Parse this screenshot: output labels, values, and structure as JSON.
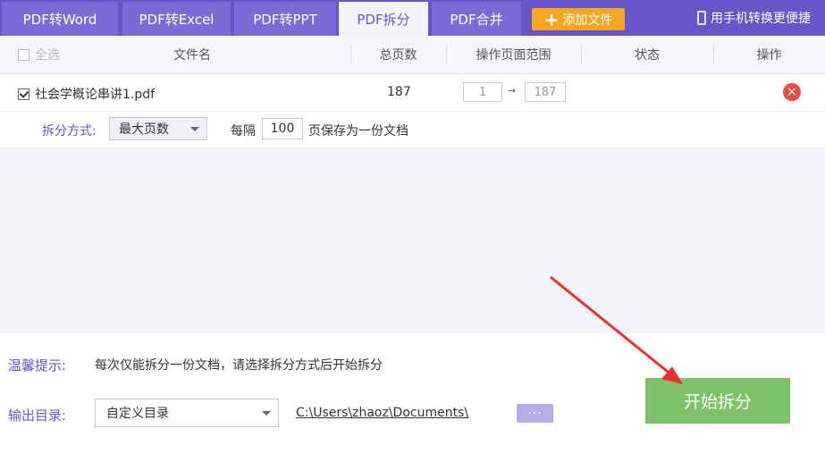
{
  "tabs": [
    {
      "label": "PDF转Word"
    },
    {
      "label": "PDF转Excel"
    },
    {
      "label": "PDF转PPT"
    },
    {
      "label": "PDF拆分"
    },
    {
      "label": "PDF合并"
    }
  ],
  "add_file_label": "添加文件",
  "mobile_label": "用手机转换更便捷",
  "table": {
    "headers": {
      "select_all": "全选",
      "filename": "文件名",
      "total_pages": "总页数",
      "page_range": "操作页面范围",
      "status": "状态",
      "action": "操作"
    },
    "rows": [
      {
        "filename": "社会学概论串讲1.pdf",
        "total_pages": "187",
        "range_start": "1",
        "range_end": "187",
        "status": ""
      }
    ]
  },
  "split": {
    "label": "拆分方式:",
    "method": "最大页数",
    "every_prefix": "每隔",
    "every_value": "100",
    "every_suffix": "页保存为一份文档"
  },
  "tip": {
    "label": "温馨提示:",
    "text": "每次仅能拆分一份文档，请选择拆分方式后开始拆分"
  },
  "output": {
    "label": "输出目录:",
    "mode": "自定义目录",
    "path": "C:\\Users\\zhaoz\\Documents\\",
    "browse_label": "···"
  },
  "start_label": "开始拆分",
  "colors": {
    "accent": "#6a55c8",
    "start": "#7ec36b",
    "add": "#f6a623",
    "delete": "#e54d4d"
  }
}
